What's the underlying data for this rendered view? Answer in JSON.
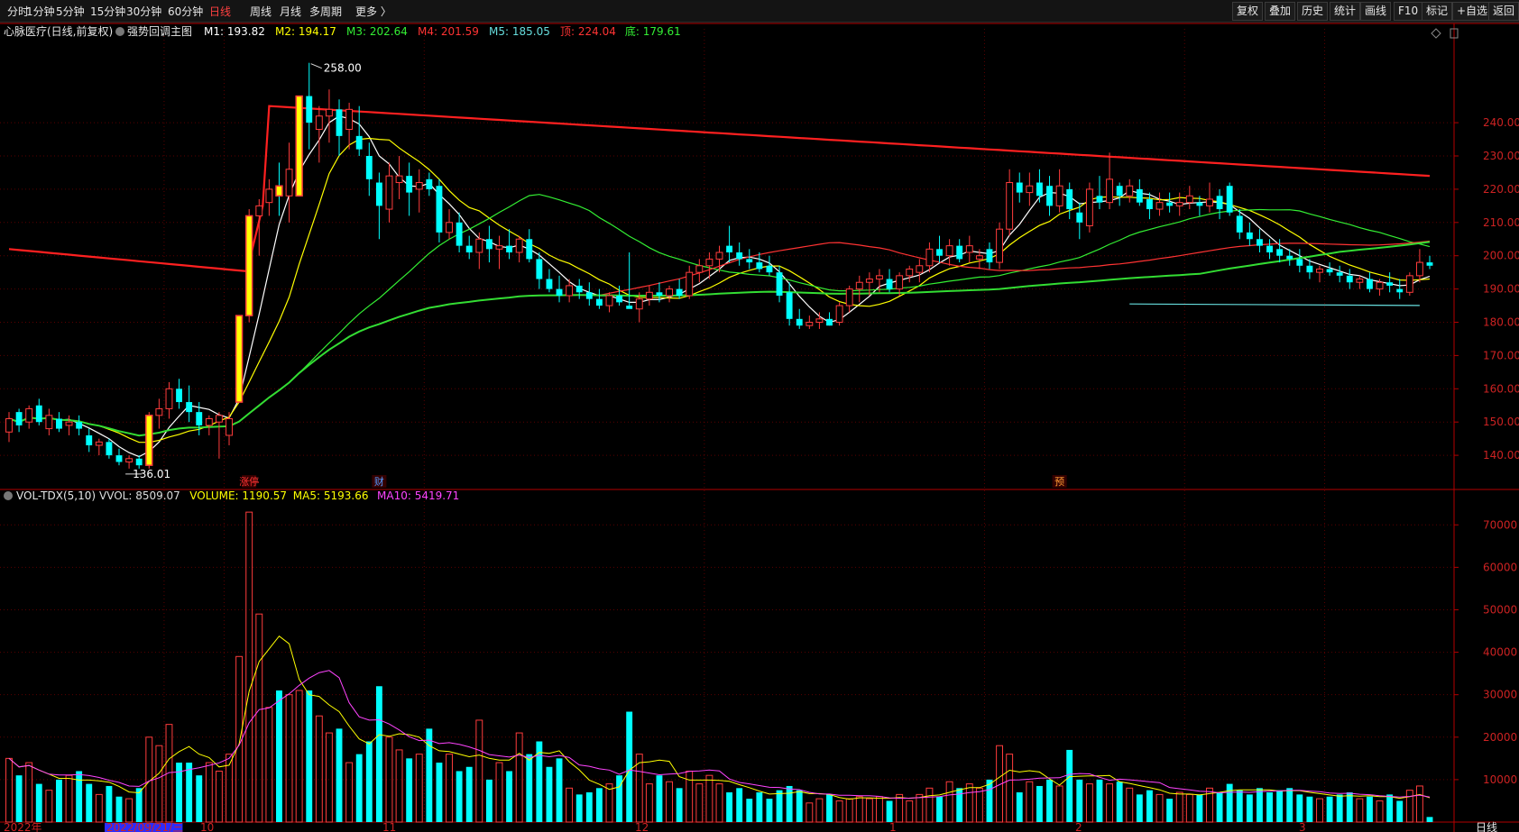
{
  "toolbar": {
    "left_items": [
      "分时",
      "1分钟",
      "5分钟",
      "15分钟",
      "30分钟",
      "60分钟",
      "日线",
      "周线",
      "月线",
      "多周期",
      "更多 〉"
    ],
    "active": "日线",
    "right_buttons": [
      "复权",
      "叠加",
      "历史",
      "统计",
      "画线",
      "F10",
      "标记",
      "+自选",
      "返回"
    ]
  },
  "main_header": {
    "stock": "心脉医疗(日线,前复权)",
    "indicator": "强势回调主图",
    "items": [
      {
        "text": "M1: 193.82",
        "color": "#ffffff"
      },
      {
        "text": "M2: 194.17",
        "color": "#ffff00"
      },
      {
        "text": "M3: 202.64",
        "color": "#33ee33"
      },
      {
        "text": "M4: 201.59",
        "color": "#ff3333"
      },
      {
        "text": "M5: 185.05",
        "color": "#66dddd"
      },
      {
        "text": "顶: 224.04",
        "color": "#ff3333"
      },
      {
        "text": "底: 179.61",
        "color": "#33ee33"
      }
    ]
  },
  "vol_header": {
    "name": "VOL-TDX(5,10)",
    "items": [
      {
        "text": "VVOL: 8509.07",
        "color": "#dddddd"
      },
      {
        "text": "VOLUME: 1190.57",
        "color": "#ffff00"
      },
      {
        "text": "MA5: 5193.66",
        "color": "#ffff00"
      },
      {
        "text": "MA10: 5419.71",
        "color": "#ff44ff"
      }
    ]
  },
  "date_axis": {
    "labels": [
      "2022年",
      "2022/09/21/三",
      "10",
      "11",
      "12",
      "1",
      "2",
      "3"
    ],
    "highlight": "2022/09/21/三"
  },
  "markers": [
    "涨停",
    "财",
    "预"
  ],
  "annotations": {
    "high": "258.00",
    "low": "136.01"
  },
  "bottom_right": "日线",
  "colors": {
    "up": "#ff3c3c",
    "down": "#00ffff",
    "limit_up": "#ffff00",
    "grid": "#5a0000",
    "axis": "#b40000"
  },
  "chart_data": {
    "type": "candlestick",
    "price_axis": {
      "ticks": [
        140,
        150,
        160,
        170,
        180,
        190,
        200,
        210,
        220,
        230,
        240
      ],
      "ylim": [
        130,
        259
      ]
    },
    "volume_axis": {
      "ticks": [
        10000,
        20000,
        30000,
        40000,
        50000,
        60000,
        70000
      ],
      "ylim": [
        0,
        76000
      ]
    },
    "candles": [
      {
        "o": 147,
        "h": 153,
        "l": 144,
        "c": 151,
        "v": 15000
      },
      {
        "o": 153,
        "h": 154,
        "l": 147,
        "c": 149,
        "v": 11000
      },
      {
        "o": 150,
        "h": 155,
        "l": 148,
        "c": 154,
        "v": 14000
      },
      {
        "o": 155,
        "h": 157,
        "l": 149,
        "c": 150,
        "v": 9000
      },
      {
        "o": 148,
        "h": 154,
        "l": 146,
        "c": 152,
        "v": 7500
      },
      {
        "o": 151,
        "h": 153,
        "l": 147,
        "c": 148,
        "v": 10000
      },
      {
        "o": 149,
        "h": 152,
        "l": 146,
        "c": 150,
        "v": 11000
      },
      {
        "o": 150,
        "h": 152,
        "l": 146,
        "c": 148,
        "v": 12000
      },
      {
        "o": 146,
        "h": 148,
        "l": 141,
        "c": 143,
        "v": 9000
      },
      {
        "o": 143,
        "h": 145,
        "l": 140,
        "c": 144,
        "v": 6500
      },
      {
        "o": 144,
        "h": 145,
        "l": 139,
        "c": 140,
        "v": 8500
      },
      {
        "o": 140,
        "h": 142,
        "l": 137,
        "c": 138,
        "v": 6000
      },
      {
        "o": 138,
        "h": 140,
        "l": 136,
        "c": 139,
        "v": 5500
      },
      {
        "o": 139,
        "h": 140,
        "l": 136,
        "c": 137,
        "v": 8000
      },
      {
        "o": 137,
        "h": 153,
        "l": 136,
        "c": 152,
        "v": 20000
      },
      {
        "o": 152,
        "h": 157,
        "l": 148,
        "c": 154,
        "v": 18000
      },
      {
        "o": 154,
        "h": 162,
        "l": 151,
        "c": 160,
        "v": 23000
      },
      {
        "o": 160,
        "h": 163,
        "l": 154,
        "c": 156,
        "v": 14000
      },
      {
        "o": 156,
        "h": 161,
        "l": 150,
        "c": 153,
        "v": 14000
      },
      {
        "o": 153,
        "h": 156,
        "l": 146,
        "c": 149,
        "v": 11000
      },
      {
        "o": 149,
        "h": 152,
        "l": 146,
        "c": 151,
        "v": 14000
      },
      {
        "o": 150,
        "h": 153,
        "l": 139,
        "c": 152,
        "v": 12000
      },
      {
        "o": 146,
        "h": 153,
        "l": 143,
        "c": 151,
        "v": 16000
      },
      {
        "o": 156,
        "h": 182,
        "l": 156,
        "c": 182,
        "v": 39000
      },
      {
        "o": 182,
        "h": 214,
        "l": 180,
        "c": 212,
        "v": 73000
      },
      {
        "o": 212,
        "h": 217,
        "l": 200,
        "c": 215,
        "v": 49000
      },
      {
        "o": 216,
        "h": 223,
        "l": 212,
        "c": 220,
        "v": 27000
      },
      {
        "o": 221,
        "h": 228,
        "l": 212,
        "c": 218,
        "v": 31000
      },
      {
        "o": 218,
        "h": 234,
        "l": 210,
        "c": 226,
        "v": 30000
      },
      {
        "o": 218,
        "h": 248,
        "l": 218,
        "c": 248,
        "v": 31000
      },
      {
        "o": 248,
        "h": 258,
        "l": 232,
        "c": 240,
        "v": 31000
      },
      {
        "o": 238,
        "h": 245,
        "l": 228,
        "c": 242,
        "v": 25000
      },
      {
        "o": 242,
        "h": 250,
        "l": 234,
        "c": 244,
        "v": 21000
      },
      {
        "o": 244,
        "h": 247,
        "l": 230,
        "c": 236,
        "v": 22000
      },
      {
        "o": 238,
        "h": 246,
        "l": 232,
        "c": 244,
        "v": 14000
      },
      {
        "o": 236,
        "h": 245,
        "l": 230,
        "c": 232,
        "v": 16000
      },
      {
        "o": 230,
        "h": 234,
        "l": 218,
        "c": 223,
        "v": 19000
      },
      {
        "o": 222,
        "h": 225,
        "l": 205,
        "c": 215,
        "v": 32000
      },
      {
        "o": 214,
        "h": 228,
        "l": 210,
        "c": 224,
        "v": 20000
      },
      {
        "o": 222,
        "h": 230,
        "l": 217,
        "c": 224,
        "v": 17000
      },
      {
        "o": 224,
        "h": 228,
        "l": 212,
        "c": 219,
        "v": 15000
      },
      {
        "o": 220,
        "h": 226,
        "l": 213,
        "c": 222,
        "v": 16000
      },
      {
        "o": 223,
        "h": 225,
        "l": 218,
        "c": 220,
        "v": 22000
      },
      {
        "o": 221,
        "h": 223,
        "l": 204,
        "c": 207,
        "v": 14000
      },
      {
        "o": 207,
        "h": 214,
        "l": 205,
        "c": 210,
        "v": 16000
      },
      {
        "o": 210,
        "h": 213,
        "l": 201,
        "c": 203,
        "v": 12000
      },
      {
        "o": 203,
        "h": 206,
        "l": 199,
        "c": 201,
        "v": 13000
      },
      {
        "o": 201,
        "h": 207,
        "l": 196,
        "c": 205,
        "v": 24000
      },
      {
        "o": 205,
        "h": 209,
        "l": 198,
        "c": 202,
        "v": 10000
      },
      {
        "o": 202,
        "h": 206,
        "l": 196,
        "c": 203,
        "v": 14000
      },
      {
        "o": 203,
        "h": 208,
        "l": 199,
        "c": 201,
        "v": 12000
      },
      {
        "o": 201,
        "h": 206,
        "l": 198,
        "c": 205,
        "v": 21000
      },
      {
        "o": 205,
        "h": 208,
        "l": 198,
        "c": 199,
        "v": 16000
      },
      {
        "o": 199,
        "h": 201,
        "l": 190,
        "c": 193,
        "v": 19000
      },
      {
        "o": 193,
        "h": 196,
        "l": 189,
        "c": 190,
        "v": 13000
      },
      {
        "o": 190,
        "h": 194,
        "l": 186,
        "c": 188,
        "v": 15000
      },
      {
        "o": 188,
        "h": 193,
        "l": 186,
        "c": 191,
        "v": 8000
      },
      {
        "o": 191,
        "h": 193,
        "l": 187,
        "c": 189,
        "v": 6500
      },
      {
        "o": 189,
        "h": 192,
        "l": 185,
        "c": 187,
        "v": 7000
      },
      {
        "o": 187,
        "h": 190,
        "l": 184,
        "c": 185,
        "v": 8000
      },
      {
        "o": 185,
        "h": 189,
        "l": 183,
        "c": 188,
        "v": 9000
      },
      {
        "o": 188,
        "h": 191,
        "l": 185,
        "c": 186,
        "v": 11000
      },
      {
        "o": 185,
        "h": 201,
        "l": 185,
        "c": 184,
        "v": 26000
      },
      {
        "o": 184,
        "h": 189,
        "l": 180,
        "c": 187,
        "v": 16000
      },
      {
        "o": 187,
        "h": 191,
        "l": 185,
        "c": 189,
        "v": 9000
      },
      {
        "o": 189,
        "h": 192,
        "l": 186,
        "c": 188,
        "v": 11000
      },
      {
        "o": 188,
        "h": 191,
        "l": 186,
        "c": 190,
        "v": 9500
      },
      {
        "o": 190,
        "h": 193,
        "l": 187,
        "c": 188,
        "v": 8000
      },
      {
        "o": 188,
        "h": 197,
        "l": 187,
        "c": 195,
        "v": 12000
      },
      {
        "o": 195,
        "h": 199,
        "l": 192,
        "c": 197,
        "v": 9000
      },
      {
        "o": 197,
        "h": 201,
        "l": 193,
        "c": 199,
        "v": 11000
      },
      {
        "o": 199,
        "h": 203,
        "l": 195,
        "c": 201,
        "v": 9000
      },
      {
        "o": 203,
        "h": 209,
        "l": 198,
        "c": 201,
        "v": 7000
      },
      {
        "o": 201,
        "h": 204,
        "l": 197,
        "c": 199,
        "v": 8000
      },
      {
        "o": 199,
        "h": 202,
        "l": 196,
        "c": 198,
        "v": 5500
      },
      {
        "o": 198,
        "h": 201,
        "l": 195,
        "c": 196,
        "v": 7000
      },
      {
        "o": 197,
        "h": 200,
        "l": 194,
        "c": 195,
        "v": 5500
      },
      {
        "o": 195,
        "h": 197,
        "l": 186,
        "c": 188,
        "v": 7500
      },
      {
        "o": 189,
        "h": 192,
        "l": 179,
        "c": 181,
        "v": 8500
      },
      {
        "o": 181,
        "h": 184,
        "l": 178,
        "c": 179,
        "v": 7500
      },
      {
        "o": 179,
        "h": 182,
        "l": 178,
        "c": 180,
        "v": 4500
      },
      {
        "o": 180,
        "h": 183,
        "l": 178,
        "c": 181,
        "v": 5500
      },
      {
        "o": 181,
        "h": 183,
        "l": 179,
        "c": 179,
        "v": 6500
      },
      {
        "o": 180,
        "h": 186,
        "l": 179,
        "c": 185,
        "v": 5000
      },
      {
        "o": 185,
        "h": 191,
        "l": 183,
        "c": 190,
        "v": 5500
      },
      {
        "o": 190,
        "h": 194,
        "l": 186,
        "c": 192,
        "v": 6000
      },
      {
        "o": 192,
        "h": 195,
        "l": 188,
        "c": 193,
        "v": 5500
      },
      {
        "o": 193,
        "h": 196,
        "l": 189,
        "c": 194,
        "v": 6000
      },
      {
        "o": 193,
        "h": 196,
        "l": 189,
        "c": 190,
        "v": 5000
      },
      {
        "o": 190,
        "h": 195,
        "l": 188,
        "c": 194,
        "v": 6500
      },
      {
        "o": 194,
        "h": 197,
        "l": 192,
        "c": 196,
        "v": 5000
      },
      {
        "o": 195,
        "h": 199,
        "l": 192,
        "c": 197,
        "v": 6500
      },
      {
        "o": 197,
        "h": 204,
        "l": 195,
        "c": 202,
        "v": 8000
      },
      {
        "o": 202,
        "h": 206,
        "l": 198,
        "c": 200,
        "v": 6000
      },
      {
        "o": 200,
        "h": 205,
        "l": 197,
        "c": 203,
        "v": 9500
      },
      {
        "o": 203,
        "h": 205,
        "l": 198,
        "c": 199,
        "v": 8000
      },
      {
        "o": 201,
        "h": 206,
        "l": 198,
        "c": 203,
        "v": 9000
      },
      {
        "o": 199,
        "h": 202,
        "l": 196,
        "c": 200,
        "v": 8000
      },
      {
        "o": 202,
        "h": 204,
        "l": 196,
        "c": 198,
        "v": 10000
      },
      {
        "o": 198,
        "h": 210,
        "l": 196,
        "c": 208,
        "v": 18000
      },
      {
        "o": 208,
        "h": 226,
        "l": 206,
        "c": 222,
        "v": 16000
      },
      {
        "o": 222,
        "h": 225,
        "l": 216,
        "c": 219,
        "v": 7000
      },
      {
        "o": 219,
        "h": 225,
        "l": 215,
        "c": 221,
        "v": 9500
      },
      {
        "o": 222,
        "h": 226,
        "l": 216,
        "c": 218,
        "v": 8500
      },
      {
        "o": 221,
        "h": 224,
        "l": 212,
        "c": 215,
        "v": 10000
      },
      {
        "o": 215,
        "h": 226,
        "l": 213,
        "c": 221,
        "v": 8500
      },
      {
        "o": 220,
        "h": 222,
        "l": 211,
        "c": 214,
        "v": 17000
      },
      {
        "o": 213,
        "h": 216,
        "l": 205,
        "c": 210,
        "v": 10000
      },
      {
        "o": 209,
        "h": 222,
        "l": 207,
        "c": 220,
        "v": 9000
      },
      {
        "o": 218,
        "h": 224,
        "l": 214,
        "c": 216,
        "v": 10000
      },
      {
        "o": 216,
        "h": 231,
        "l": 214,
        "c": 223,
        "v": 9000
      },
      {
        "o": 221,
        "h": 222,
        "l": 215,
        "c": 218,
        "v": 9500
      },
      {
        "o": 218,
        "h": 223,
        "l": 216,
        "c": 221,
        "v": 8000
      },
      {
        "o": 220,
        "h": 223,
        "l": 215,
        "c": 216,
        "v": 6500
      },
      {
        "o": 217,
        "h": 219,
        "l": 211,
        "c": 214,
        "v": 7500
      },
      {
        "o": 214,
        "h": 219,
        "l": 212,
        "c": 216,
        "v": 6500
      },
      {
        "o": 216,
        "h": 219,
        "l": 213,
        "c": 215,
        "v": 5500
      },
      {
        "o": 215,
        "h": 219,
        "l": 212,
        "c": 216,
        "v": 7000
      },
      {
        "o": 216,
        "h": 221,
        "l": 214,
        "c": 218,
        "v": 6500
      },
      {
        "o": 216,
        "h": 218,
        "l": 212,
        "c": 215,
        "v": 6500
      },
      {
        "o": 215,
        "h": 222,
        "l": 213,
        "c": 217,
        "v": 8000
      },
      {
        "o": 218,
        "h": 220,
        "l": 211,
        "c": 214,
        "v": 7000
      },
      {
        "o": 221,
        "h": 222,
        "l": 212,
        "c": 213,
        "v": 9000
      },
      {
        "o": 212,
        "h": 214,
        "l": 205,
        "c": 207,
        "v": 7500
      },
      {
        "o": 207,
        "h": 210,
        "l": 203,
        "c": 205,
        "v": 6500
      },
      {
        "o": 205,
        "h": 208,
        "l": 201,
        "c": 203,
        "v": 8000
      },
      {
        "o": 203,
        "h": 205,
        "l": 199,
        "c": 201,
        "v": 7000
      },
      {
        "o": 202,
        "h": 205,
        "l": 198,
        "c": 200,
        "v": 7500
      },
      {
        "o": 200,
        "h": 202,
        "l": 197,
        "c": 199,
        "v": 8000
      },
      {
        "o": 199,
        "h": 202,
        "l": 195,
        "c": 197,
        "v": 6500
      },
      {
        "o": 197,
        "h": 199,
        "l": 193,
        "c": 195,
        "v": 6000
      },
      {
        "o": 195,
        "h": 197,
        "l": 192,
        "c": 196,
        "v": 5500
      },
      {
        "o": 196,
        "h": 198,
        "l": 194,
        "c": 195,
        "v": 6000
      },
      {
        "o": 195,
        "h": 197,
        "l": 192,
        "c": 194,
        "v": 6500
      },
      {
        "o": 194,
        "h": 196,
        "l": 190,
        "c": 192,
        "v": 7000
      },
      {
        "o": 192,
        "h": 194,
        "l": 190,
        "c": 193,
        "v": 5500
      },
      {
        "o": 193,
        "h": 195,
        "l": 189,
        "c": 190,
        "v": 6000
      },
      {
        "o": 190,
        "h": 193,
        "l": 188,
        "c": 192,
        "v": 5000
      },
      {
        "o": 192,
        "h": 195,
        "l": 189,
        "c": 191,
        "v": 6500
      },
      {
        "o": 190,
        "h": 193,
        "l": 187,
        "c": 189,
        "v": 5000
      },
      {
        "o": 189,
        "h": 195,
        "l": 188,
        "c": 194,
        "v": 7500
      },
      {
        "o": 194,
        "h": 202,
        "l": 192,
        "c": 198,
        "v": 8500
      },
      {
        "o": 198,
        "h": 200,
        "l": 196,
        "c": 197,
        "v": 1200
      }
    ],
    "limit_up_candles": [
      14,
      23,
      24,
      27,
      29
    ]
  }
}
